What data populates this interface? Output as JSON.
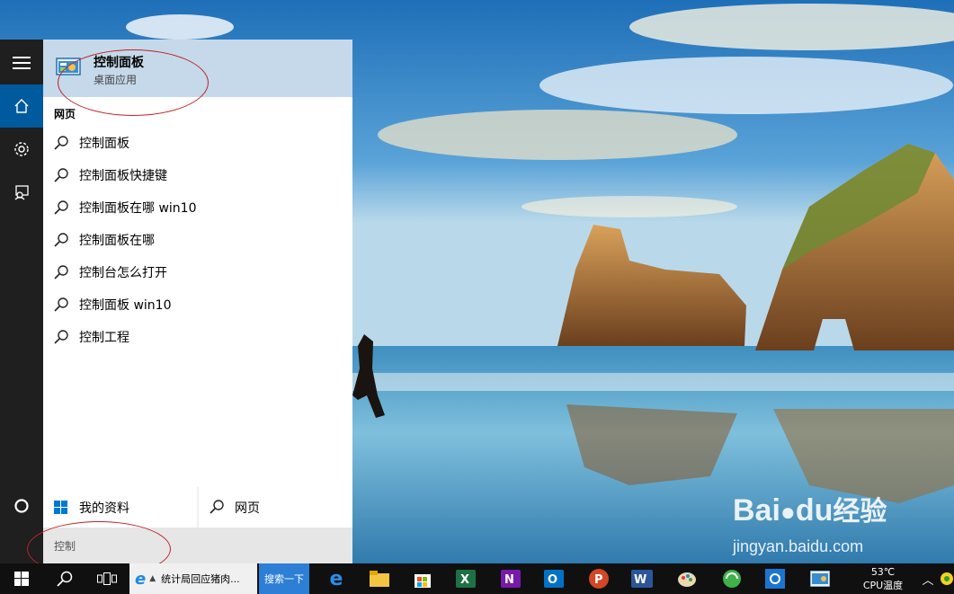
{
  "colors": {
    "accent": "#005a9e",
    "best_match_bg": "#c5d9ea",
    "annotation": "#c0202a",
    "taskbar": "#101010"
  },
  "best_match": {
    "icon": "control-panel-icon",
    "title": "控制面板",
    "subtitle": "桌面应用"
  },
  "web_section": {
    "label": "网页"
  },
  "suggestions": [
    {
      "text": "控制面板",
      "icon": "search-icon"
    },
    {
      "text": "控制面板快捷键",
      "icon": "search-icon"
    },
    {
      "text": "控制面板在哪 win10",
      "icon": "search-icon"
    },
    {
      "text": "控制面板在哪",
      "icon": "search-icon"
    },
    {
      "text": "控制台怎么打开",
      "icon": "search-icon"
    },
    {
      "text": "控制面板 win10",
      "icon": "search-icon"
    },
    {
      "text": "控制工程",
      "icon": "search-icon"
    }
  ],
  "filters": {
    "my_stuff": "我的资料",
    "web": "网页"
  },
  "search": {
    "value": "控制"
  },
  "rail": [
    "menu-icon",
    "home-icon",
    "gear-icon",
    "feedback-icon",
    "cortana-icon"
  ],
  "taskbar": {
    "ie_window_title": "统计局回应猪肉...",
    "search_button": "搜索一下",
    "temperature": "53℃",
    "cpu_label": "CPU温度"
  },
  "watermark": {
    "brand": "Bai",
    "brand2": "du",
    "suffix": "经验",
    "url": "jingyan.baidu.com"
  }
}
